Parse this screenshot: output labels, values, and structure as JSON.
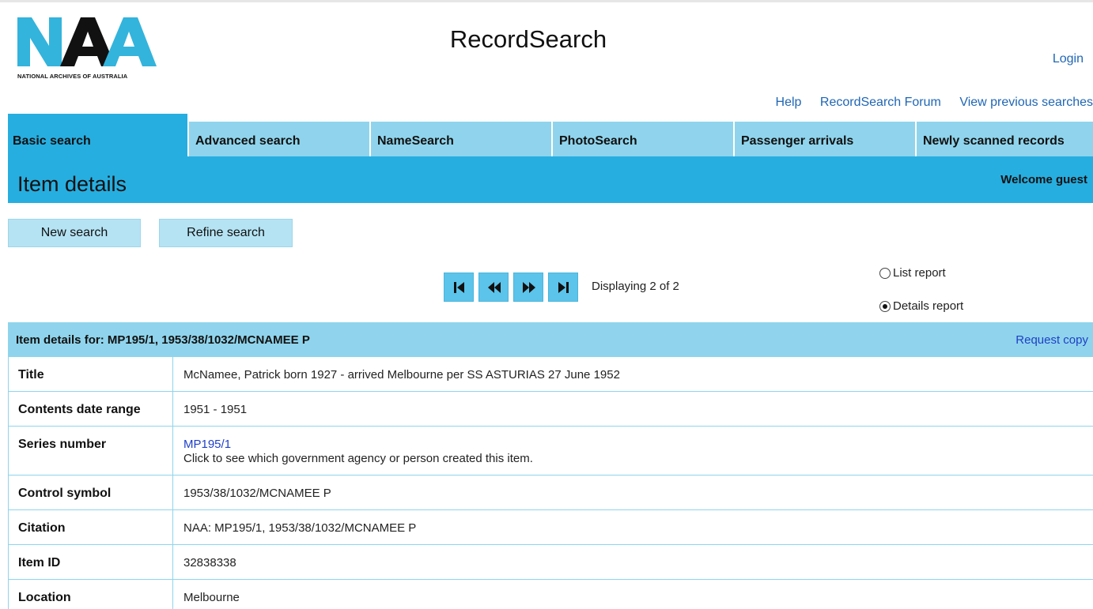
{
  "header": {
    "logo_text": "NAA",
    "logo_caption": "NATIONAL ARCHIVES OF AUSTRALIA",
    "app_title": "RecordSearch",
    "login": "Login",
    "links": [
      "Help",
      "RecordSearch Forum",
      "View previous searches"
    ]
  },
  "tabs": [
    {
      "label": "Basic search",
      "active": true
    },
    {
      "label": "Advanced search",
      "active": false
    },
    {
      "label": "NameSearch",
      "active": false
    },
    {
      "label": "PhotoSearch",
      "active": false
    },
    {
      "label": "Passenger arrivals",
      "active": false
    },
    {
      "label": "Newly scanned records",
      "active": false
    }
  ],
  "band": {
    "page_title": "Item details",
    "welcome": "Welcome guest"
  },
  "actions": {
    "new_search": "New search",
    "refine_search": "Refine search"
  },
  "pager": {
    "displaying": "Displaying 2 of 2"
  },
  "report_options": [
    {
      "label": "List report",
      "selected": false
    },
    {
      "label": "Details report",
      "selected": true
    }
  ],
  "details": {
    "heading": "Item details for: MP195/1, 1953/38/1032/MCNAMEE P",
    "request_copy": "Request copy",
    "rows": [
      {
        "label": "Title",
        "value": "McNamee, Patrick born 1927 - arrived Melbourne per SS ASTURIAS 27 June 1952"
      },
      {
        "label": "Contents date range",
        "value": "1951 - 1951"
      },
      {
        "label": "Series number",
        "link": "MP195/1",
        "value": "Click to see which government agency or person created this item."
      },
      {
        "label": "Control symbol",
        "value": "1953/38/1032/MCNAMEE P"
      },
      {
        "label": "Citation",
        "value": "NAA: MP195/1, 1953/38/1032/MCNAMEE P"
      },
      {
        "label": "Item ID",
        "value": "32838338"
      },
      {
        "label": "Location",
        "value": "Melbourne"
      }
    ]
  },
  "colors": {
    "brand_blue": "#27aee0",
    "light_blue": "#8fd4ec",
    "link_blue": "#1f66b5",
    "logo_cyan": "#33b4dc",
    "logo_black": "#111111"
  }
}
